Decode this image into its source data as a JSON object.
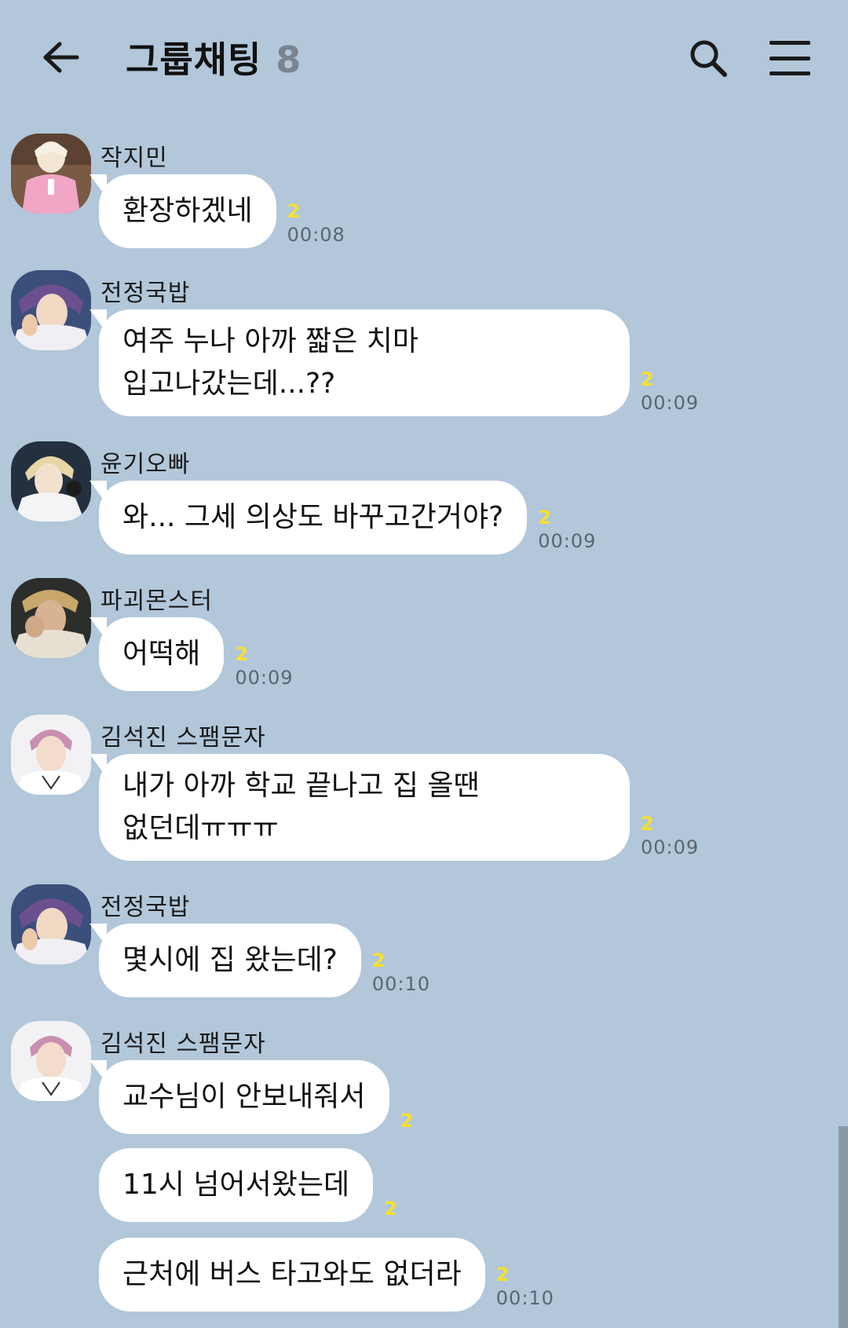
{
  "header": {
    "title": "그룹채팅",
    "member_count": "8"
  },
  "messages": [
    {
      "sender": "작지민",
      "text": "환장하겠네",
      "unread": "2",
      "time": "00:08"
    },
    {
      "sender": "전정국밥",
      "text": "여주 누나 아까 짧은 치마\n입고나갔는데...??",
      "unread": "2",
      "time": "00:09"
    },
    {
      "sender": "윤기오빠",
      "text": "와... 그세 의상도 바꾸고간거야?",
      "unread": "2",
      "time": "00:09"
    },
    {
      "sender": "파괴몬스터",
      "text": "어떡해",
      "unread": "2",
      "time": "00:09"
    },
    {
      "sender": "김석진 스팸문자",
      "text": "내가 아까 학교 끝나고 집 올땐\n없던데ㅠㅠㅠ",
      "unread": "2",
      "time": "00:09"
    },
    {
      "sender": "전정국밥",
      "text": "몇시에 집 왔는데?",
      "unread": "2",
      "time": "00:10"
    },
    {
      "sender": "김석진 스팸문자",
      "text": "교수님이 안보내줘서",
      "unread": "2",
      "time": ""
    },
    {
      "sender": "",
      "text": "11시 넘어서왔는데",
      "unread": "2",
      "time": ""
    },
    {
      "sender": "",
      "text": "근처에 버스 타고와도 없더라",
      "unread": "2",
      "time": "00:10"
    }
  ],
  "icons": {
    "back": "arrow-left-icon",
    "search": "search-icon",
    "menu": "hamburger-menu-icon"
  },
  "colors": {
    "background": "#b2c7da",
    "bubble": "#ffffff",
    "unread": "#f6df2f",
    "time": "#5a6570"
  }
}
